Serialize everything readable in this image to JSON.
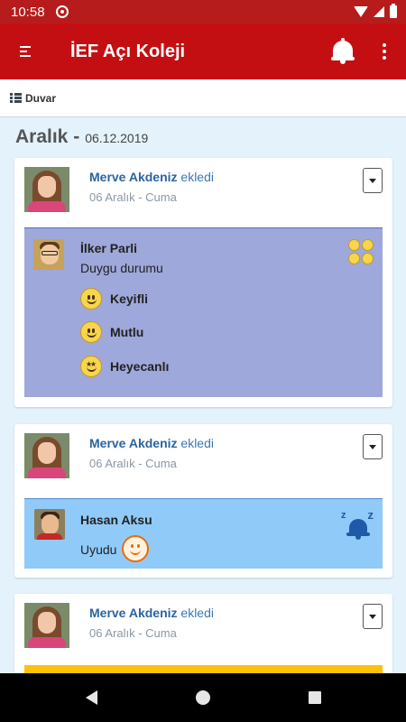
{
  "status_bar": {
    "time": "10:58"
  },
  "app_bar": {
    "title": "İEF Açı Koleji"
  },
  "tab": {
    "label": "Duvar"
  },
  "section": {
    "month": "Aralık -",
    "date": "06.12.2019"
  },
  "posts": [
    {
      "author": "Merve Akdeniz",
      "action": "ekledi",
      "date": "06 Aralık - Cuma",
      "child": "İlker Parli",
      "subtitle": "Duygu durumu",
      "moods": [
        "Keyifli",
        "Mutlu",
        "Heyecanlı"
      ],
      "panel_color": "#9fa8da"
    },
    {
      "author": "Merve Akdeniz",
      "action": "ekledi",
      "date": "06 Aralık - Cuma",
      "child": "Hasan Aksu",
      "status": "Uyudu",
      "panel_color": "#90caf9"
    },
    {
      "author": "Merve Akdeniz",
      "action": "ekledi",
      "date": "06 Aralık - Cuma",
      "panel_color": "#ffc107"
    }
  ],
  "colors": {
    "app_bar": "#c40f12",
    "status_bar": "#b71c1c",
    "background": "#e3f2fb",
    "author": "#2a64a0"
  }
}
